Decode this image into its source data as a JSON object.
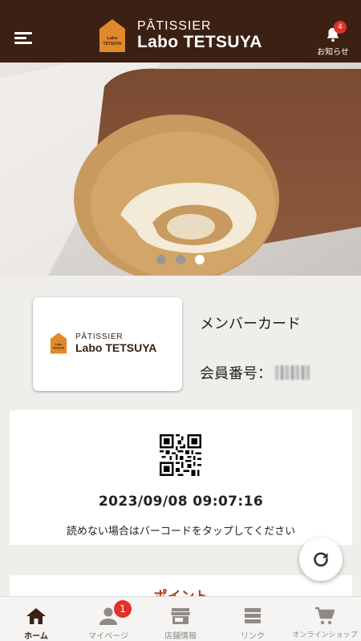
{
  "header": {
    "logo_top": "PÂTISSIER",
    "logo_main": "Labo TETSUYA",
    "logo_house_text": "Labo TETSUYA",
    "notice_label": "お知らせ",
    "notice_count": "4"
  },
  "hero": {
    "slides": 3,
    "active_slide": 3
  },
  "member": {
    "card_logo_top": "PÂTISSIER",
    "card_logo_main": "Labo TETSUYA",
    "title": "メンバーカード",
    "number_label": "会員番号："
  },
  "qr": {
    "timestamp": "2023/09/08 09:07:16",
    "hint": "読めない場合はバーコードをタップしてください"
  },
  "point": {
    "title": "ポイント"
  },
  "tabs": [
    {
      "label": "ホーム",
      "icon": "home-icon",
      "active": true
    },
    {
      "label": "マイページ",
      "icon": "person-icon",
      "badge": "1"
    },
    {
      "label": "店舗情報",
      "icon": "store-icon"
    },
    {
      "label": "リンク",
      "icon": "list-icon"
    },
    {
      "label": "オンラインショップ",
      "icon": "cart-icon"
    }
  ],
  "colors": {
    "header_bg": "#3b2013",
    "accent": "#b23a1d",
    "badge": "#e0312a",
    "logo_orange": "#e08a2c"
  }
}
